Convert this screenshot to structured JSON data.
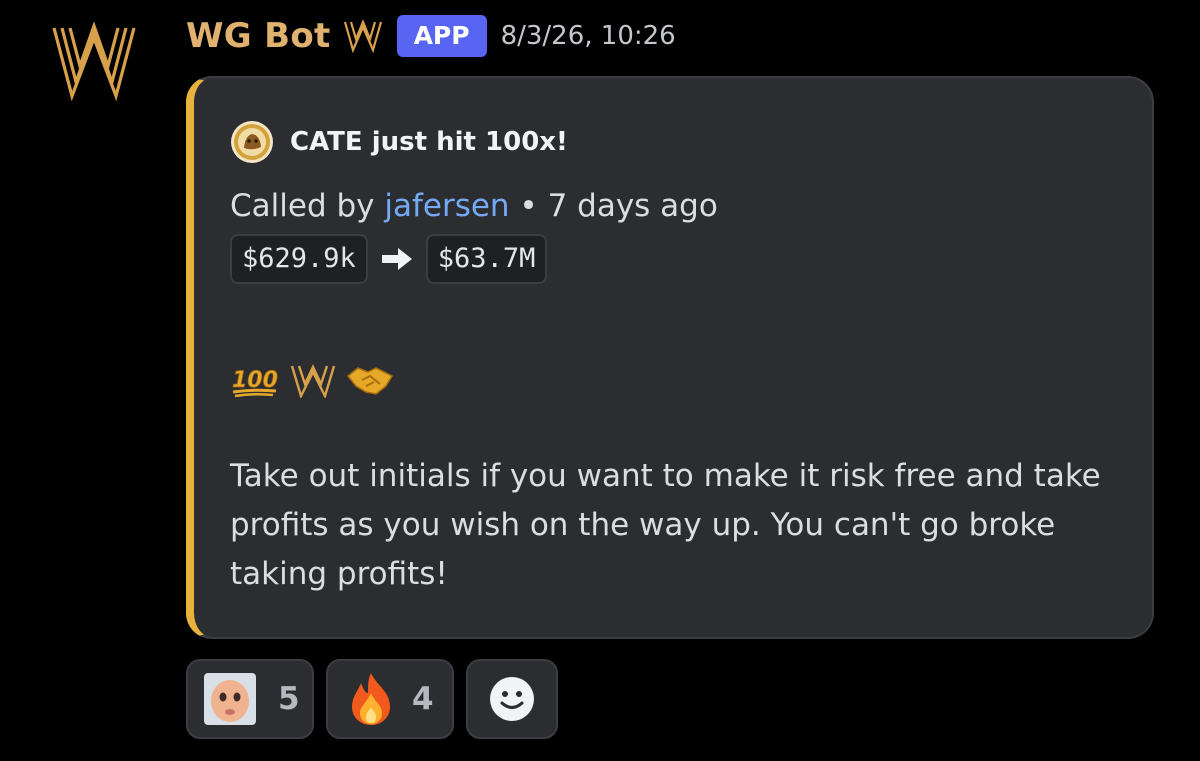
{
  "message": {
    "author": {
      "name": "WG Bot",
      "avatar_icon": "gold-w-logo-icon",
      "badge_icon": "gold-w-badge-icon",
      "tag": "APP"
    },
    "timestamp": "8/3/26, 10:26"
  },
  "embed": {
    "accent_color": "#e9b23c",
    "author_icon": "token-coin-icon",
    "title": "CATE just hit 100x!",
    "called_by_prefix": "Called by",
    "caller": "jafersen",
    "called_suffix": " • 7 days ago",
    "price_from": "$629.9k",
    "price_to": "$63.7M",
    "arrow_icon": "right-arrow-icon",
    "emojis": [
      "hundred-points-icon",
      "gold-w-icon",
      "handshake-icon"
    ],
    "body": "Take out initials if you want to make it risk free and take profits as you wish on the way up. You can't go broke taking profits!"
  },
  "reactions": [
    {
      "icon": "baby-face-emoji-icon",
      "count": "5"
    },
    {
      "icon": "fire-icon",
      "count": "4"
    },
    {
      "icon": "add-reaction-smiley-icon",
      "count": ""
    }
  ],
  "colors": {
    "background": "#000000",
    "username": "#e1b26f",
    "app_tag": "#5865f2",
    "link": "#74a9f4",
    "embed_bg": "#2b2d31"
  }
}
